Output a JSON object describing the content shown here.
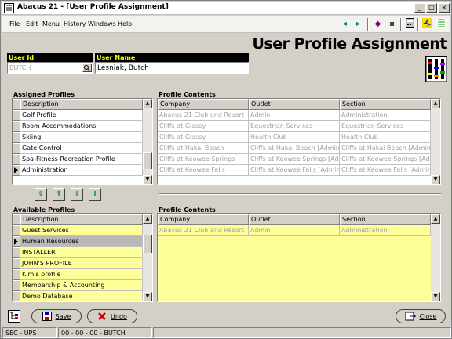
{
  "app": {
    "title": "Abacus 21 - [User Profile Assignment]"
  },
  "menu": [
    "File",
    "Edit",
    "Menu",
    "History",
    "Windows",
    "Help"
  ],
  "page_title": "User Profile Assignment",
  "user": {
    "id_label": "User Id",
    "id_value": "BUTCH",
    "name_label": "User Name",
    "name_value": "Lesniak, Butch"
  },
  "assigned": {
    "label": "Assigned Profiles",
    "header": "Description",
    "rows": [
      "Golf Profile",
      "Room Accommodations",
      "Skiing",
      "Gate Control",
      "Spa-Fitness-Recreation Profile",
      "Administration"
    ]
  },
  "contents_top": {
    "label": "Profile Contents",
    "headers": [
      "Company",
      "Outlet",
      "Section"
    ],
    "rows": [
      [
        "Abacus 21 Club and Resort",
        "Admin",
        "Administration"
      ],
      [
        "Cliffs at Glassy",
        "Equestrian Services",
        "Equestrian Services"
      ],
      [
        "Cliffs at Glassy",
        "Health Club",
        "Health Club"
      ],
      [
        "Cliffs at Hakai Beach",
        "Cliffs at Hakai Beach [Admin]",
        "Cliffs at Hakai Beach [Admin]"
      ],
      [
        "Cliffs at Keowee Springs",
        "Cliffs at Keowee Springs [Admin]",
        "Cliffs at Keowee Springs [Admin]"
      ],
      [
        "Cliffs at Keowee Falls",
        "Cliffs at Keowee Falls [Admin]",
        "Cliffs at Keowee Falls [Admin]"
      ]
    ]
  },
  "available": {
    "label": "Available Profiles",
    "header": "Description",
    "rows": [
      "Guest Services",
      "Human Resources",
      "INSTALLER",
      "JOHN'S PROFILE",
      "Kim's profile",
      "Membership & Accounting",
      "Demo Database"
    ]
  },
  "contents_bottom": {
    "label": "Profile Contents",
    "headers": [
      "Company",
      "Outlet",
      "Section"
    ],
    "rows": [
      [
        "Abacus 21 Club and Resort",
        "Admin",
        "Administration"
      ]
    ]
  },
  "buttons": {
    "save": "Save",
    "undo": "Undo",
    "close": "Close"
  },
  "status": {
    "left": "SEC - UPS",
    "right": "00 - 00 - 00 - BUTCH"
  }
}
